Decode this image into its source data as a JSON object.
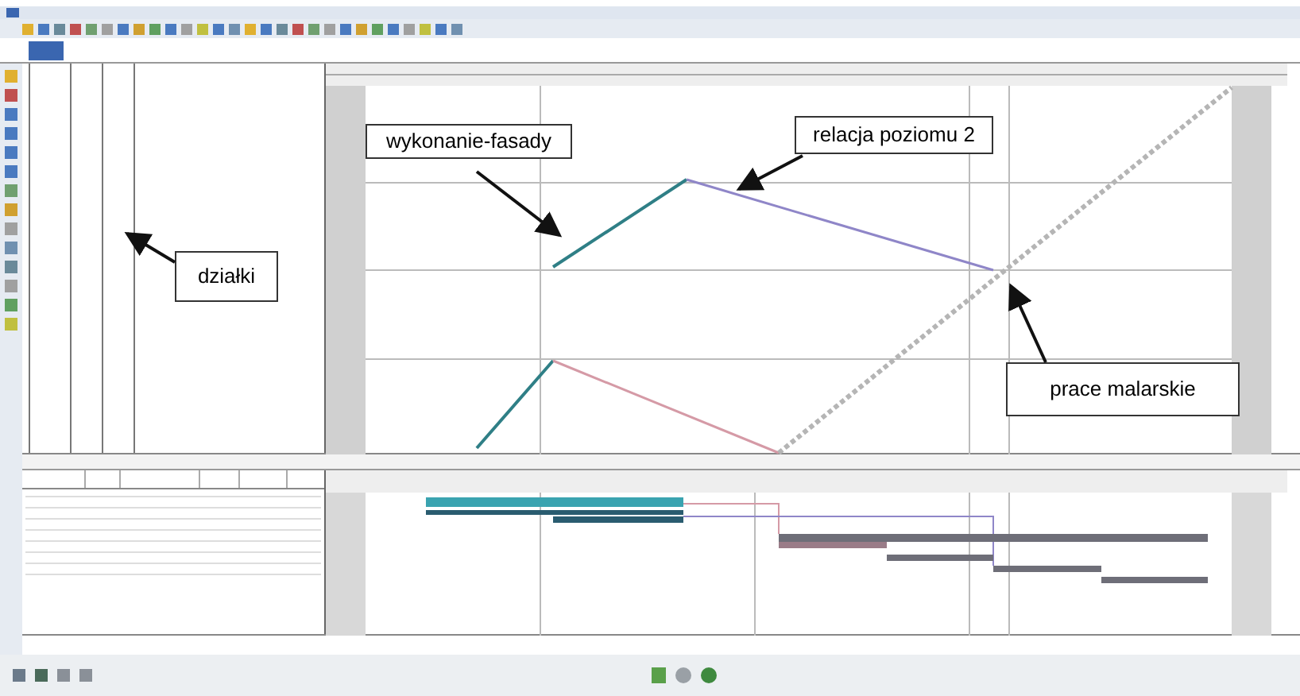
{
  "annotations": [
    {
      "label": "wykonanie-fasady"
    },
    {
      "label": "relacja poziomu 2"
    },
    {
      "label": "działki"
    },
    {
      "label": "prace malarskie"
    }
  ]
}
